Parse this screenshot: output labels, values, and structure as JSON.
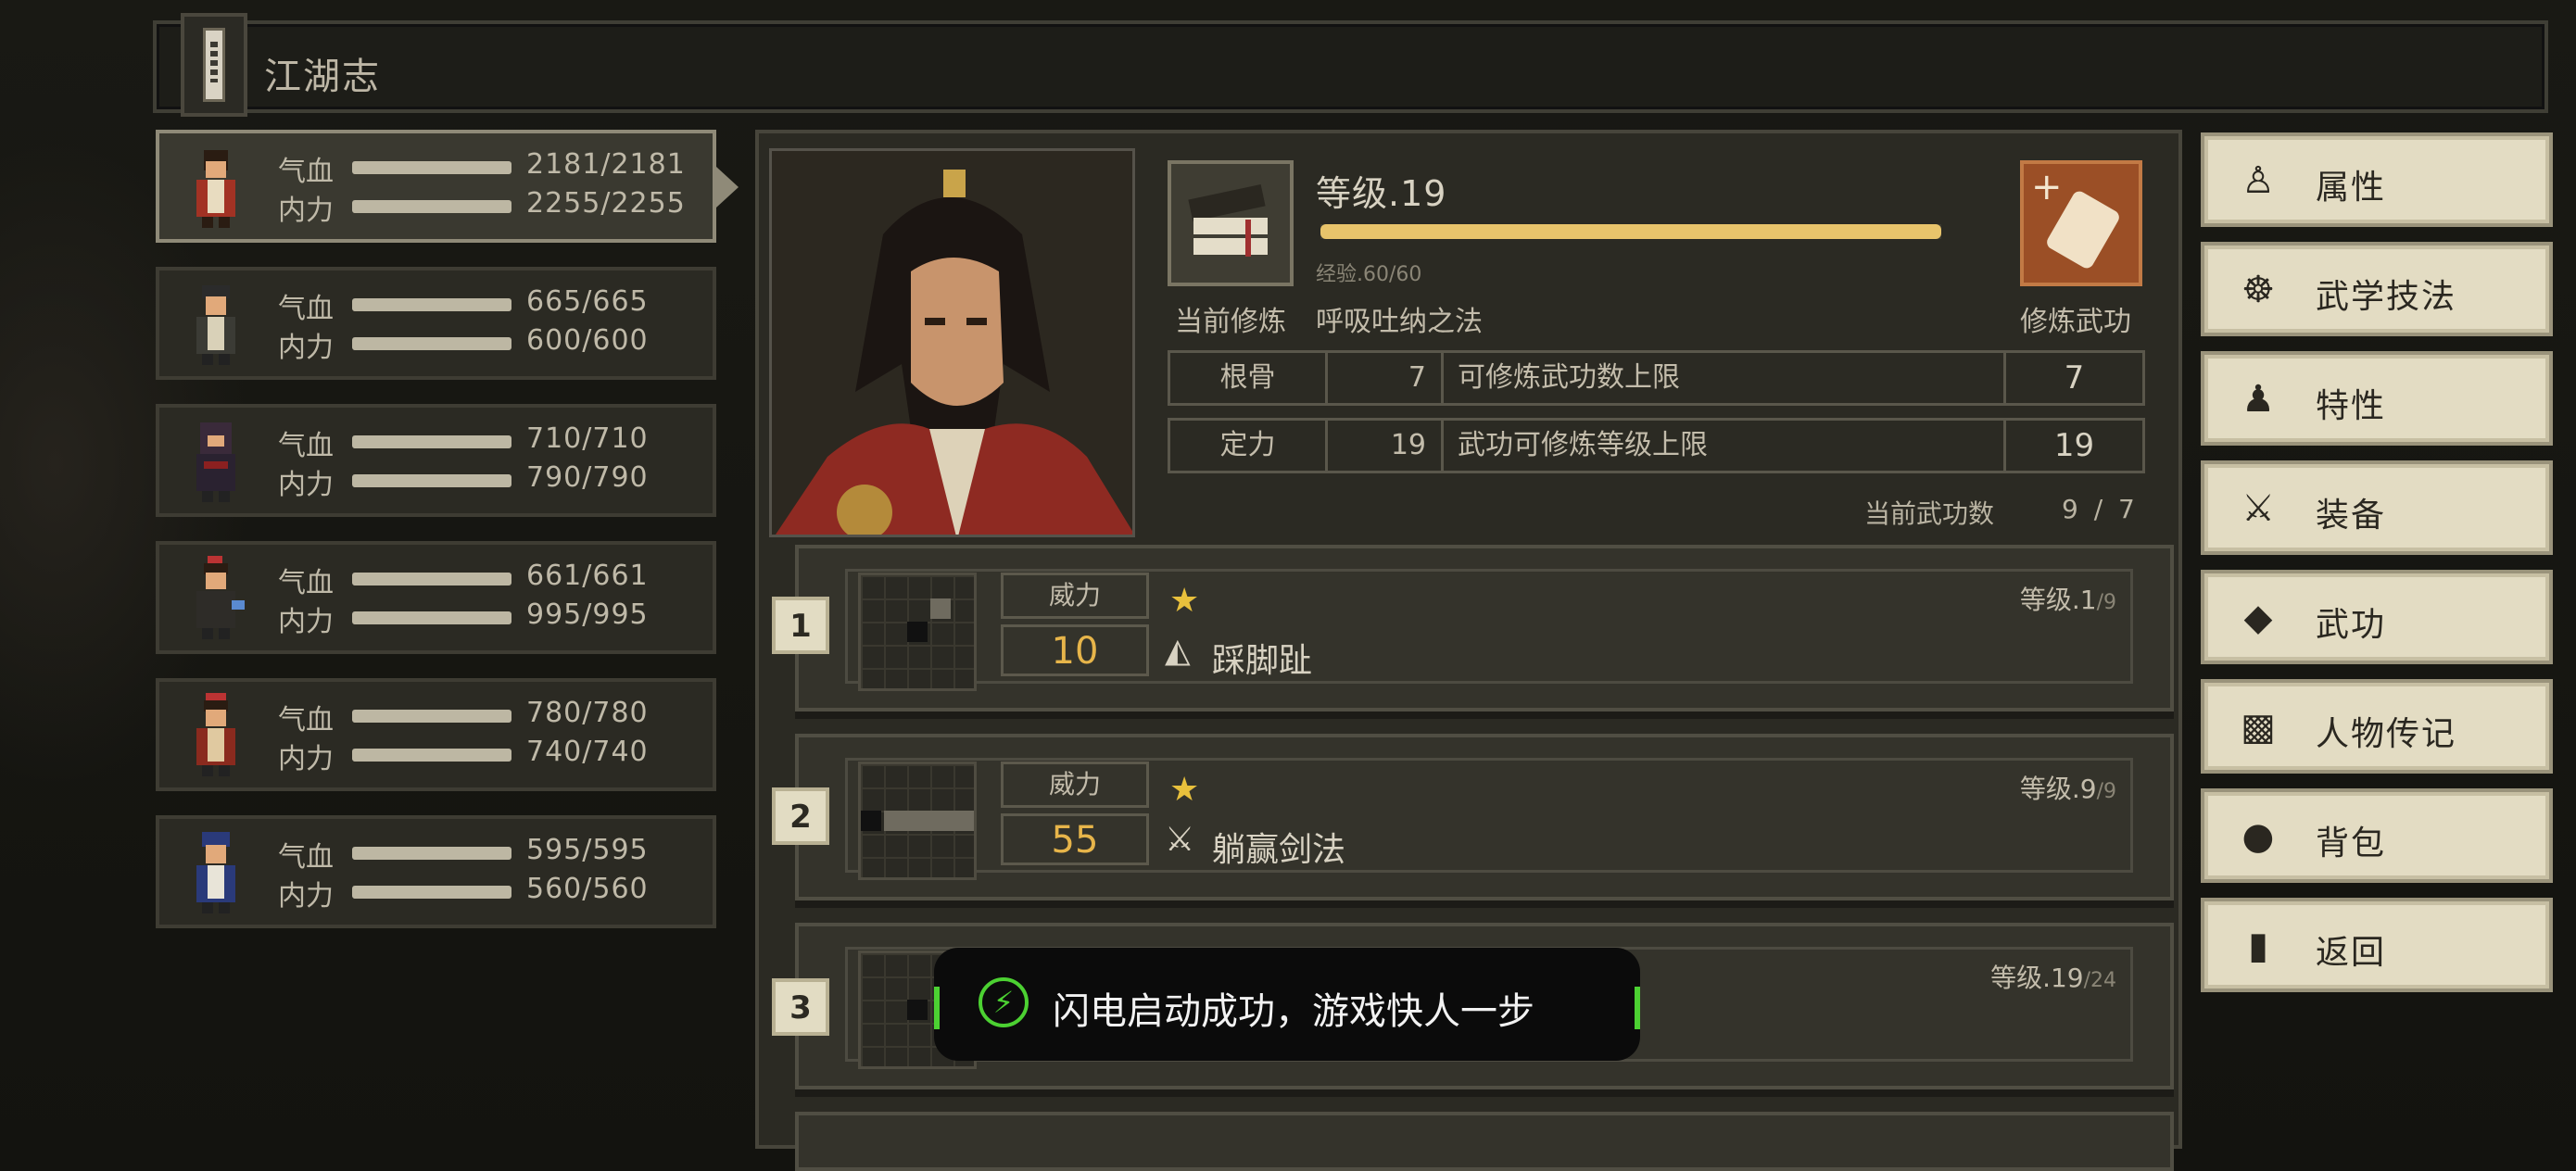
{
  "window": {
    "title": "江湖志"
  },
  "party": [
    {
      "hp_label": "气血",
      "hp": "2181/2181",
      "mp_label": "内力",
      "mp": "2255/2255",
      "active": true
    },
    {
      "hp_label": "气血",
      "hp": "665/665",
      "mp_label": "内力",
      "mp": "600/600"
    },
    {
      "hp_label": "气血",
      "hp": "710/710",
      "mp_label": "内力",
      "mp": "790/790"
    },
    {
      "hp_label": "气血",
      "hp": "661/661",
      "mp_label": "内力",
      "mp": "995/995"
    },
    {
      "hp_label": "气血",
      "hp": "780/780",
      "mp_label": "内力",
      "mp": "740/740"
    },
    {
      "hp_label": "气血",
      "hp": "595/595",
      "mp_label": "内力",
      "mp": "560/560"
    }
  ],
  "character": {
    "level_label": "等级.19",
    "exp_label": "经验.60/60",
    "exp_fraction": 1.0,
    "current_practice_label": "当前修炼",
    "current_practice": "呼吸吐纳之法",
    "train_button": "修炼武功",
    "attributes": [
      {
        "name": "根骨",
        "value": "7",
        "desc": "可修炼武功数上限",
        "cap": "7"
      },
      {
        "name": "定力",
        "value": "19",
        "desc": "武功可修炼等级上限",
        "cap": "19"
      }
    ],
    "count_label": "当前武功数",
    "count_value": "9 / 7"
  },
  "skills": [
    {
      "index": "1",
      "power_label": "威力",
      "power": "10",
      "name": "踩脚趾",
      "icon": "boot-icon",
      "level": "等级.1",
      "level_max": "/9"
    },
    {
      "index": "2",
      "power_label": "威力",
      "power": "55",
      "name": "躺赢剑法",
      "icon": "sword-icon",
      "level": "等级.9",
      "level_max": "/9"
    },
    {
      "index": "3",
      "level": "等级.19",
      "level_max": "/24"
    }
  ],
  "menu": [
    {
      "label": "属性",
      "icon": "person-icon"
    },
    {
      "label": "武学技法",
      "icon": "meditate-icon"
    },
    {
      "label": "特性",
      "icon": "trait-icon"
    },
    {
      "label": "装备",
      "icon": "sword-icon"
    },
    {
      "label": "武功",
      "icon": "scroll-icon"
    },
    {
      "label": "人物传记",
      "icon": "book-icon"
    },
    {
      "label": "背包",
      "icon": "bag-icon"
    },
    {
      "label": "返回",
      "icon": "door-icon"
    }
  ],
  "toast": {
    "text": "闪电启动成功，游戏快人一步"
  }
}
